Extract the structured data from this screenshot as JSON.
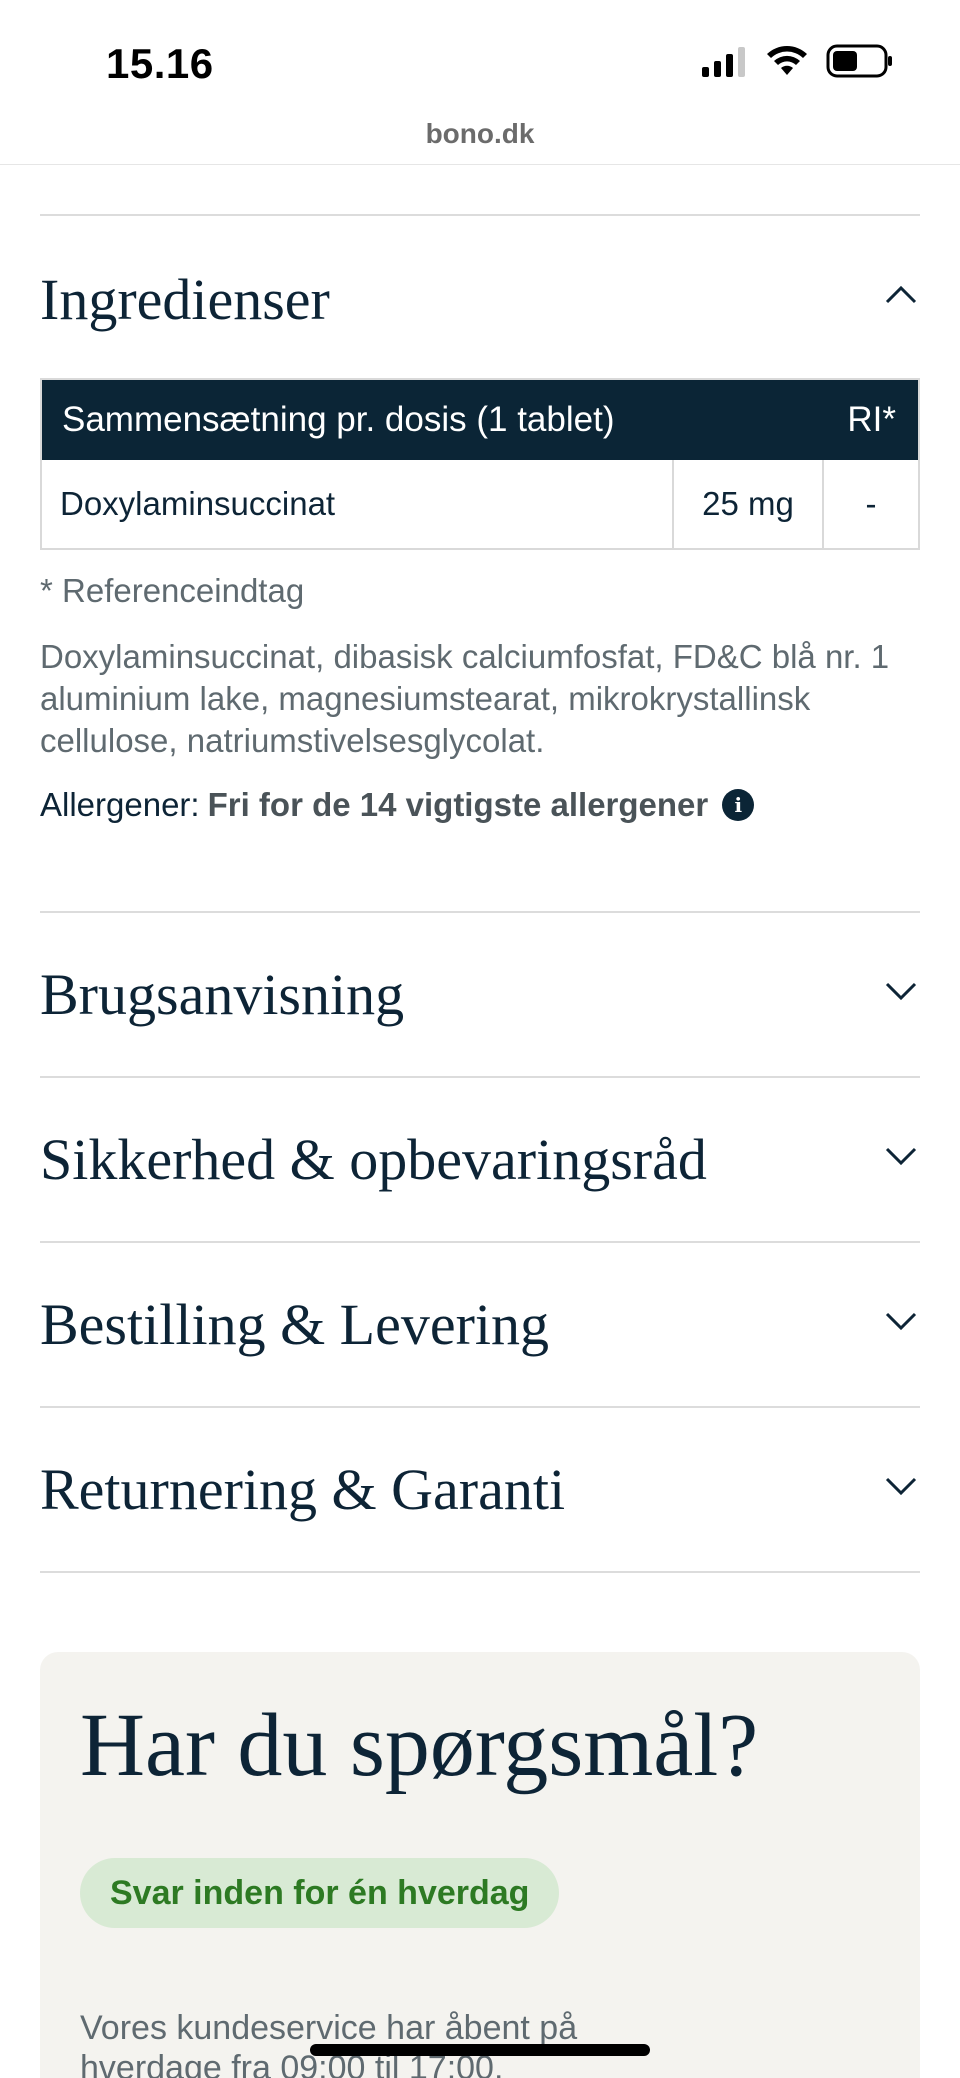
{
  "status_bar": {
    "time": "15.16"
  },
  "browser": {
    "url": "bono.dk"
  },
  "sections": {
    "ingredients": {
      "title": "Ingredienser",
      "table": {
        "header_label": "Sammensætning pr. dosis (1 tablet)",
        "header_ri": "RI*",
        "rows": [
          {
            "name": "Doxylaminsuccinat",
            "amount": "25 mg",
            "ri": "-"
          }
        ]
      },
      "footnote": "* Referenceindtag",
      "ingredients_text": "Doxylaminsuccinat, dibasisk calciumfosfat, FD&C blå nr. 1 aluminium lake, magnesiumstearat, mikrokrystallinsk cellulose, natriumstivelsesglycolat.",
      "allergens_label": "Allergener:",
      "allergens_value": "Fri for de 14 vigtigste allergener"
    },
    "usage": {
      "title": "Brugsanvisning"
    },
    "safety": {
      "title": "Sikkerhed & opbevaringsråd"
    },
    "ordering": {
      "title": "Bestilling & Levering"
    },
    "returns": {
      "title": "Returnering & Garanti"
    }
  },
  "contact": {
    "title": "Har du spørgsmål?",
    "badge": "Svar inden for én hverdag",
    "text": "Vores kundeservice har åbent på hverdage fra 09:00 til 17:00."
  },
  "colors": {
    "navy": "#0b2536",
    "badge_bg": "#d8ead4",
    "badge_text": "#2d7a23",
    "card_bg": "#f4f3ef"
  },
  "icons": {
    "expanded": "chevron-up-icon",
    "collapsed": "chevron-down-icon",
    "info": "info-icon"
  }
}
